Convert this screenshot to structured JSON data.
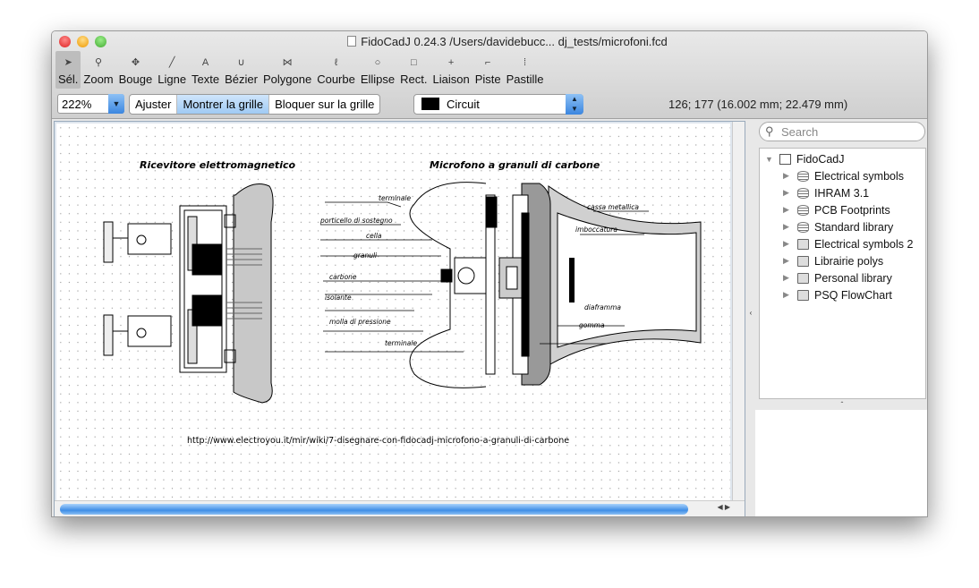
{
  "window": {
    "title": "FidoCadJ 0.24.3 /Users/davidebucc...  dj_tests/microfoni.fcd"
  },
  "toolbar": {
    "tools": [
      {
        "label": "Sél.",
        "icon": "arrow-icon"
      },
      {
        "label": "Zoom",
        "icon": "magnifier-icon"
      },
      {
        "label": "Bouge",
        "icon": "move-icon"
      },
      {
        "label": "Ligne",
        "icon": "line-icon"
      },
      {
        "label": "Texte",
        "icon": "text-icon"
      },
      {
        "label": "Bézier",
        "icon": "bezier-icon"
      },
      {
        "label": "Polygone",
        "icon": "polygon-icon"
      },
      {
        "label": "Courbe",
        "icon": "curve-icon"
      },
      {
        "label": "Ellipse",
        "icon": "ellipse-icon"
      },
      {
        "label": "Rect.",
        "icon": "rectangle-icon"
      },
      {
        "label": "Liaison",
        "icon": "connection-icon"
      },
      {
        "label": "Piste",
        "icon": "track-icon"
      },
      {
        "label": "Pastille",
        "icon": "pad-icon"
      }
    ],
    "zoom": "222%",
    "fit": "Ajuster",
    "show_grid": "Montrer la grille",
    "snap_grid": "Bloquer sur la grille",
    "layer": "Circuit",
    "layer_color": "#000000",
    "coords": "126; 177 (16.002 mm; 22.479 mm)"
  },
  "drawing": {
    "title_left": "Ricevitore elettromagnetico",
    "title_right": "Microfono a granuli di carbone",
    "labels": [
      "terminale",
      "porticello di sostegno",
      "cella",
      "granuli",
      "carbone",
      "isolante",
      "molla di pressione",
      "terminale",
      "cassa metallica",
      "imboccatura",
      "diaframma",
      "gomma"
    ],
    "url": "http://www.electroyou.it/mir/wiki/7-disegnare-con-fidocadj-microfono-a-granuli-di-carbone"
  },
  "sidebar": {
    "search_placeholder": "Search",
    "root": "FidoCadJ",
    "items": [
      {
        "label": "Electrical symbols",
        "icon": "database-icon"
      },
      {
        "label": "IHRAM 3.1",
        "icon": "database-icon"
      },
      {
        "label": "PCB Footprints",
        "icon": "database-icon"
      },
      {
        "label": "Standard library",
        "icon": "database-icon"
      },
      {
        "label": "Electrical symbols 2",
        "icon": "floppy-icon"
      },
      {
        "label": "Librairie polys",
        "icon": "floppy-icon"
      },
      {
        "label": "Personal library",
        "icon": "floppy-icon"
      },
      {
        "label": "PSQ FlowChart",
        "icon": "floppy-icon"
      }
    ]
  }
}
